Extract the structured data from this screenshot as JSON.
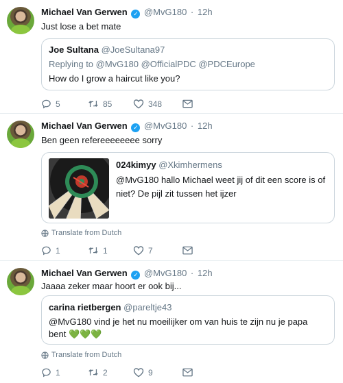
{
  "tweets": [
    {
      "name": "Michael Van Gerwen",
      "handle": "@MvG180",
      "time": "12h",
      "text": "Just lose a bet mate",
      "quote": {
        "name": "Joe Sultana",
        "handle": "@JoeSultana97",
        "replying_to": "Replying to @MvG180 @OfficialPDC @PDCEurope",
        "text": "How do I grow a haircut like you?"
      },
      "replies": "5",
      "retweets": "85",
      "likes": "348"
    },
    {
      "name": "Michael Van Gerwen",
      "handle": "@MvG180",
      "time": "12h",
      "text": "Ben geen refereeeeeeee sorry",
      "quote": {
        "name": "024kimyy",
        "handle": "@Xkimhermens",
        "text": "@MvG180 hallo Michael weet jij of dit een score is of niet? De pijl zit tussen het ijzer"
      },
      "translate": "Translate from Dutch",
      "replies": "1",
      "retweets": "1",
      "likes": "7"
    },
    {
      "name": "Michael Van Gerwen",
      "handle": "@MvG180",
      "time": "12h",
      "text": "Jaaaa zeker maar hoort er ook bij...",
      "quote": {
        "name": "carina rietbergen",
        "handle": "@pareltje43",
        "text": "@MvG180 vind je het nu moeilijker om van huis te zijn nu je papa bent",
        "emoji": "💚💚💚"
      },
      "translate": "Translate from Dutch",
      "replies": "1",
      "retweets": "2",
      "likes": "9"
    }
  ],
  "icons": {
    "verified": "verified-badge-icon",
    "reply": "reply-icon",
    "retweet": "retweet-icon",
    "like": "heart-icon",
    "message": "envelope-icon",
    "globe": "globe-icon"
  },
  "colors": {
    "accent": "#1da1f2",
    "muted": "#657786",
    "border": "#e6ecf0",
    "emoji_green": "#77b255"
  }
}
